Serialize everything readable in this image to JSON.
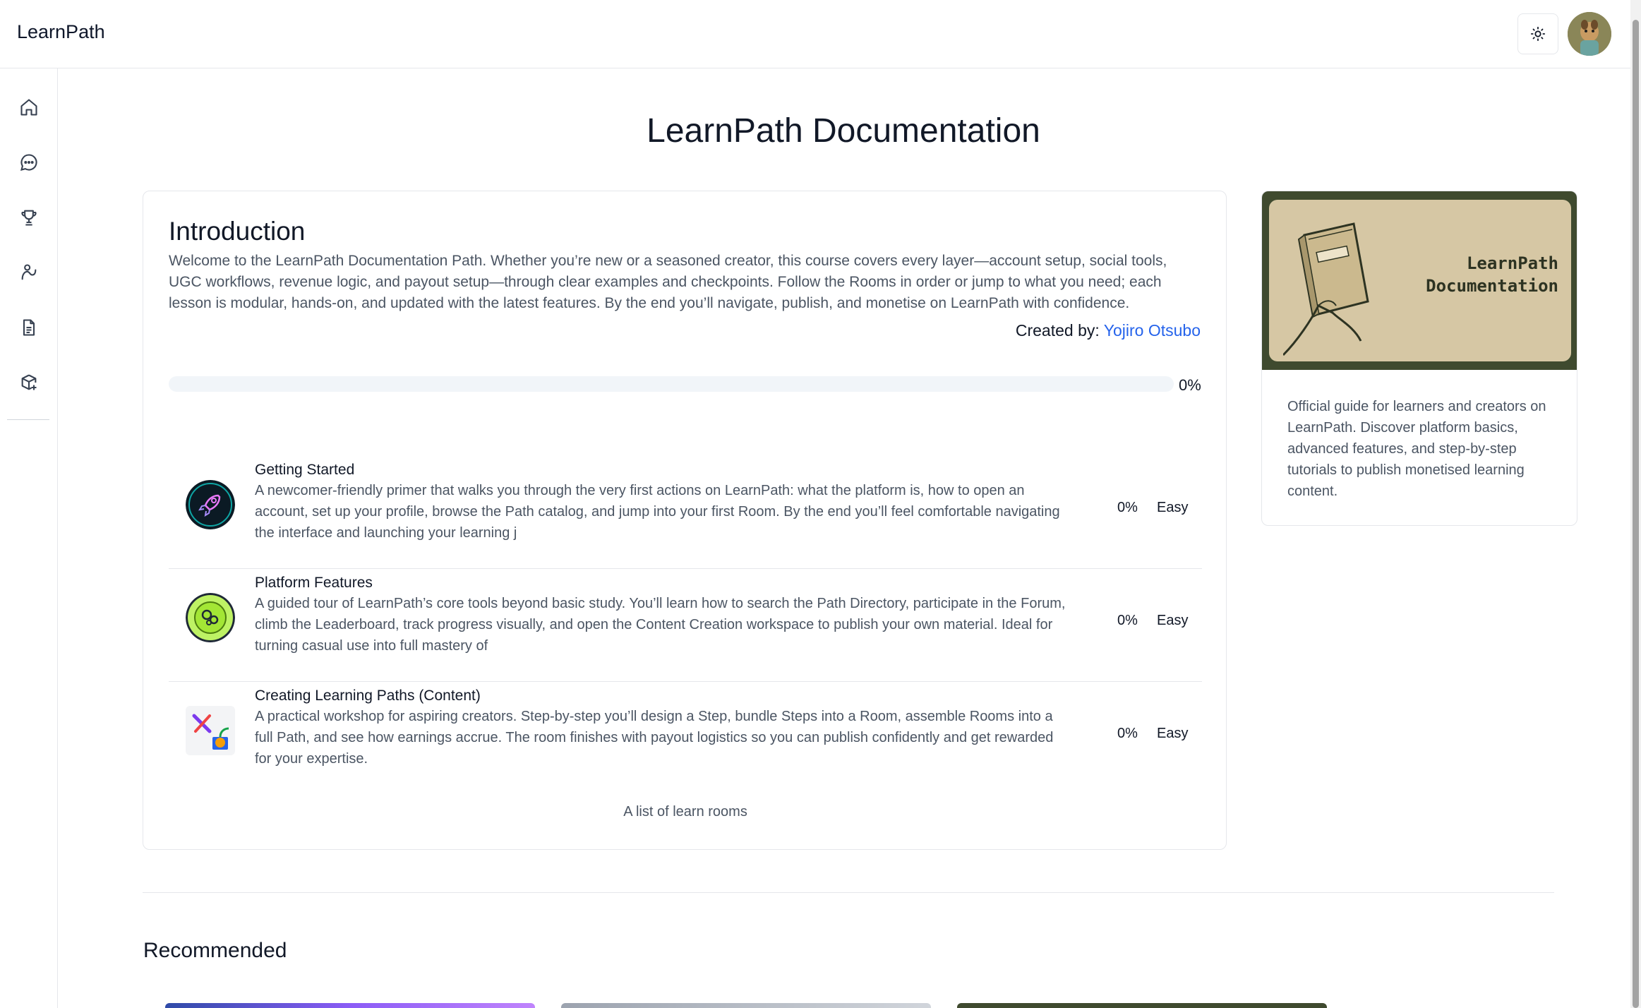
{
  "app": {
    "brand": "LearnPath"
  },
  "sidebar": {
    "items": [
      {
        "icon": "home-icon"
      },
      {
        "icon": "chat-icon"
      },
      {
        "icon": "trophy-icon"
      },
      {
        "icon": "activity-icon"
      },
      {
        "icon": "document-icon"
      },
      {
        "icon": "package-plus-icon"
      }
    ]
  },
  "page": {
    "title": "LearnPath Documentation"
  },
  "intro": {
    "title": "Introduction",
    "text": "Welcome to the LearnPath Documentation Path. Whether you’re new or a seasoned creator, this course covers every layer—account setup, social tools, UGC workflows, revenue logic, and payout setup—through clear examples and checkpoints. Follow the Rooms in order or jump to what you need; each lesson is modular, hands-on, and updated with the latest features. By the end you’ll navigate, publish, and monetise on LearnPath with confidence.",
    "created_by_label": "Created by: ",
    "creator": "Yojiro Otsubo",
    "progress_value": 0,
    "progress_label": "0%"
  },
  "rooms": [
    {
      "title": "Getting Started",
      "description": "A newcomer-friendly primer that walks you through the very first actions on LearnPath: what the platform is, how to open an account, set up your profile, browse the Path catalog, and jump into your first Room. By the end you’ll feel comfortable navigating the interface and launching your learning j",
      "progress": "0%",
      "level": "Easy"
    },
    {
      "title": "Platform Features",
      "description": "A guided tour of LearnPath’s core tools beyond basic study. You’ll learn how to search the Path Directory, participate in the Forum, climb the Leaderboard, track progress visually, and open the Content Creation workspace to publish your own material. Ideal for turning casual use into full mastery of",
      "progress": "0%",
      "level": "Easy"
    },
    {
      "title": "Creating Learning Paths (Content)",
      "description": "A practical workshop for aspiring creators. Step-by-step you’ll design a Step, bundle Steps into a Room, assemble Rooms into a full Path, and see how earnings accrue. The room finishes with payout logistics so you can publish confidently and get rewarded for your expertise.",
      "progress": "0%",
      "level": "Easy"
    }
  ],
  "rooms_caption": "A list of learn rooms",
  "path_card": {
    "cover_title_line1": "LearnPath",
    "cover_title_line2": "Documentation",
    "description": "Official guide for learners and creators on LearnPath. Discover platform basics, advanced features, and step-by-step tutorials to publish monetised learning content."
  },
  "recommended": {
    "title": "Recommended"
  },
  "colors": {
    "accent": "#2563eb",
    "cover_bg": "#3f4a2f",
    "cover_inner": "#d6c7a4"
  }
}
